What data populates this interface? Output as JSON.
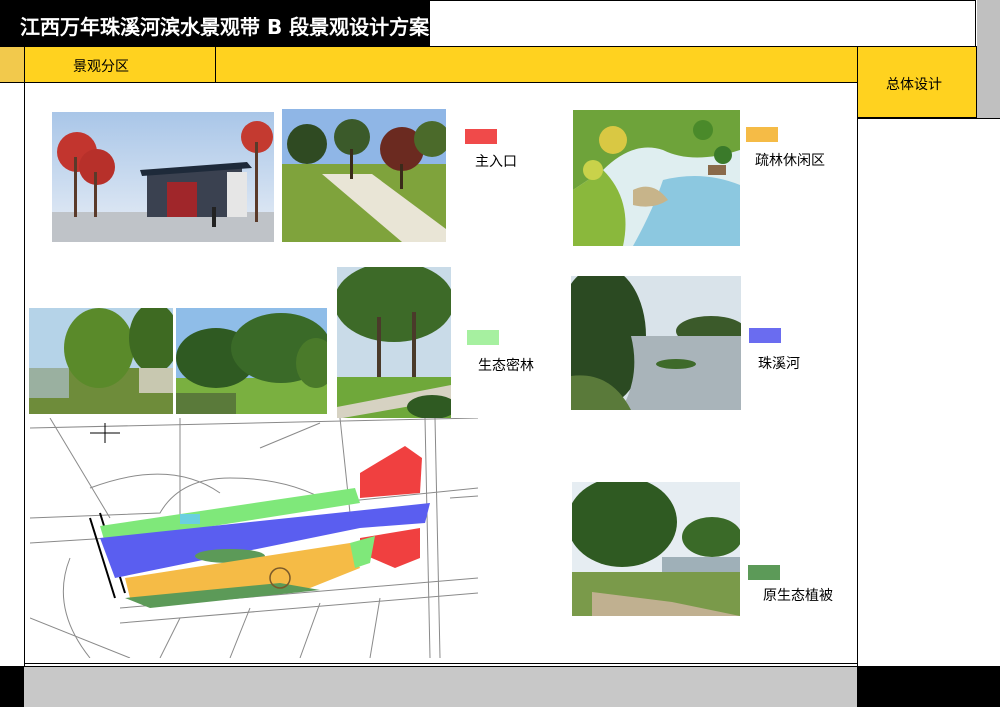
{
  "header": {
    "title": "江西万年珠溪河滨水景观带 B 段景观设计方案"
  },
  "tabs": {
    "current": "景观分区",
    "section": "总体设计"
  },
  "legend": [
    {
      "label": "主入口",
      "color": "#f04a4a"
    },
    {
      "label": "疏林休闲区",
      "color": "#f5bb46"
    },
    {
      "label": "生态密林",
      "color": "#a6f0a0"
    },
    {
      "label": "珠溪河",
      "color": "#6a6cf0"
    },
    {
      "label": "原生态植被",
      "color": "#5c9a58"
    }
  ],
  "colors": {
    "header_bg": "#000000",
    "band_yellow": "#ffd21f",
    "footer_gray": "#c8c8c8"
  }
}
